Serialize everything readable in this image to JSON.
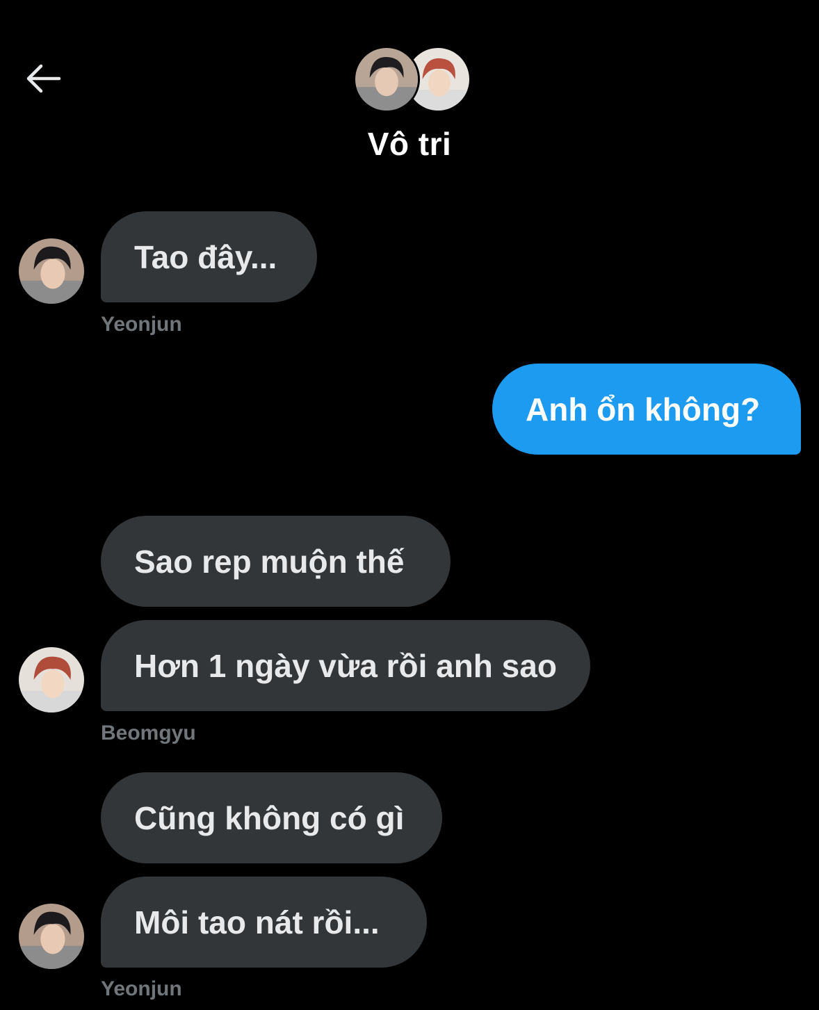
{
  "header": {
    "title": "Vô tri"
  },
  "messages": [
    {
      "text": "Tao đây...",
      "direction": "incoming"
    },
    {
      "sender": "Yeonjun"
    },
    {
      "text": "Anh ổn không?",
      "direction": "outgoing"
    },
    {
      "text": "Sao rep muộn thế",
      "direction": "incoming"
    },
    {
      "text": "Hơn 1 ngày vừa rồi anh sao",
      "direction": "incoming"
    },
    {
      "sender": "Beomgyu"
    },
    {
      "text": "Cũng không có gì",
      "direction": "incoming"
    },
    {
      "text": "Môi tao nát rồi...",
      "direction": "incoming"
    },
    {
      "sender": "Yeonjun"
    }
  ],
  "colors": {
    "background": "#000000",
    "incoming_bubble": "#333639",
    "outgoing_bubble": "#1d9bf0",
    "sender_label": "#71767b"
  },
  "icons": [
    "back-arrow-icon"
  ]
}
